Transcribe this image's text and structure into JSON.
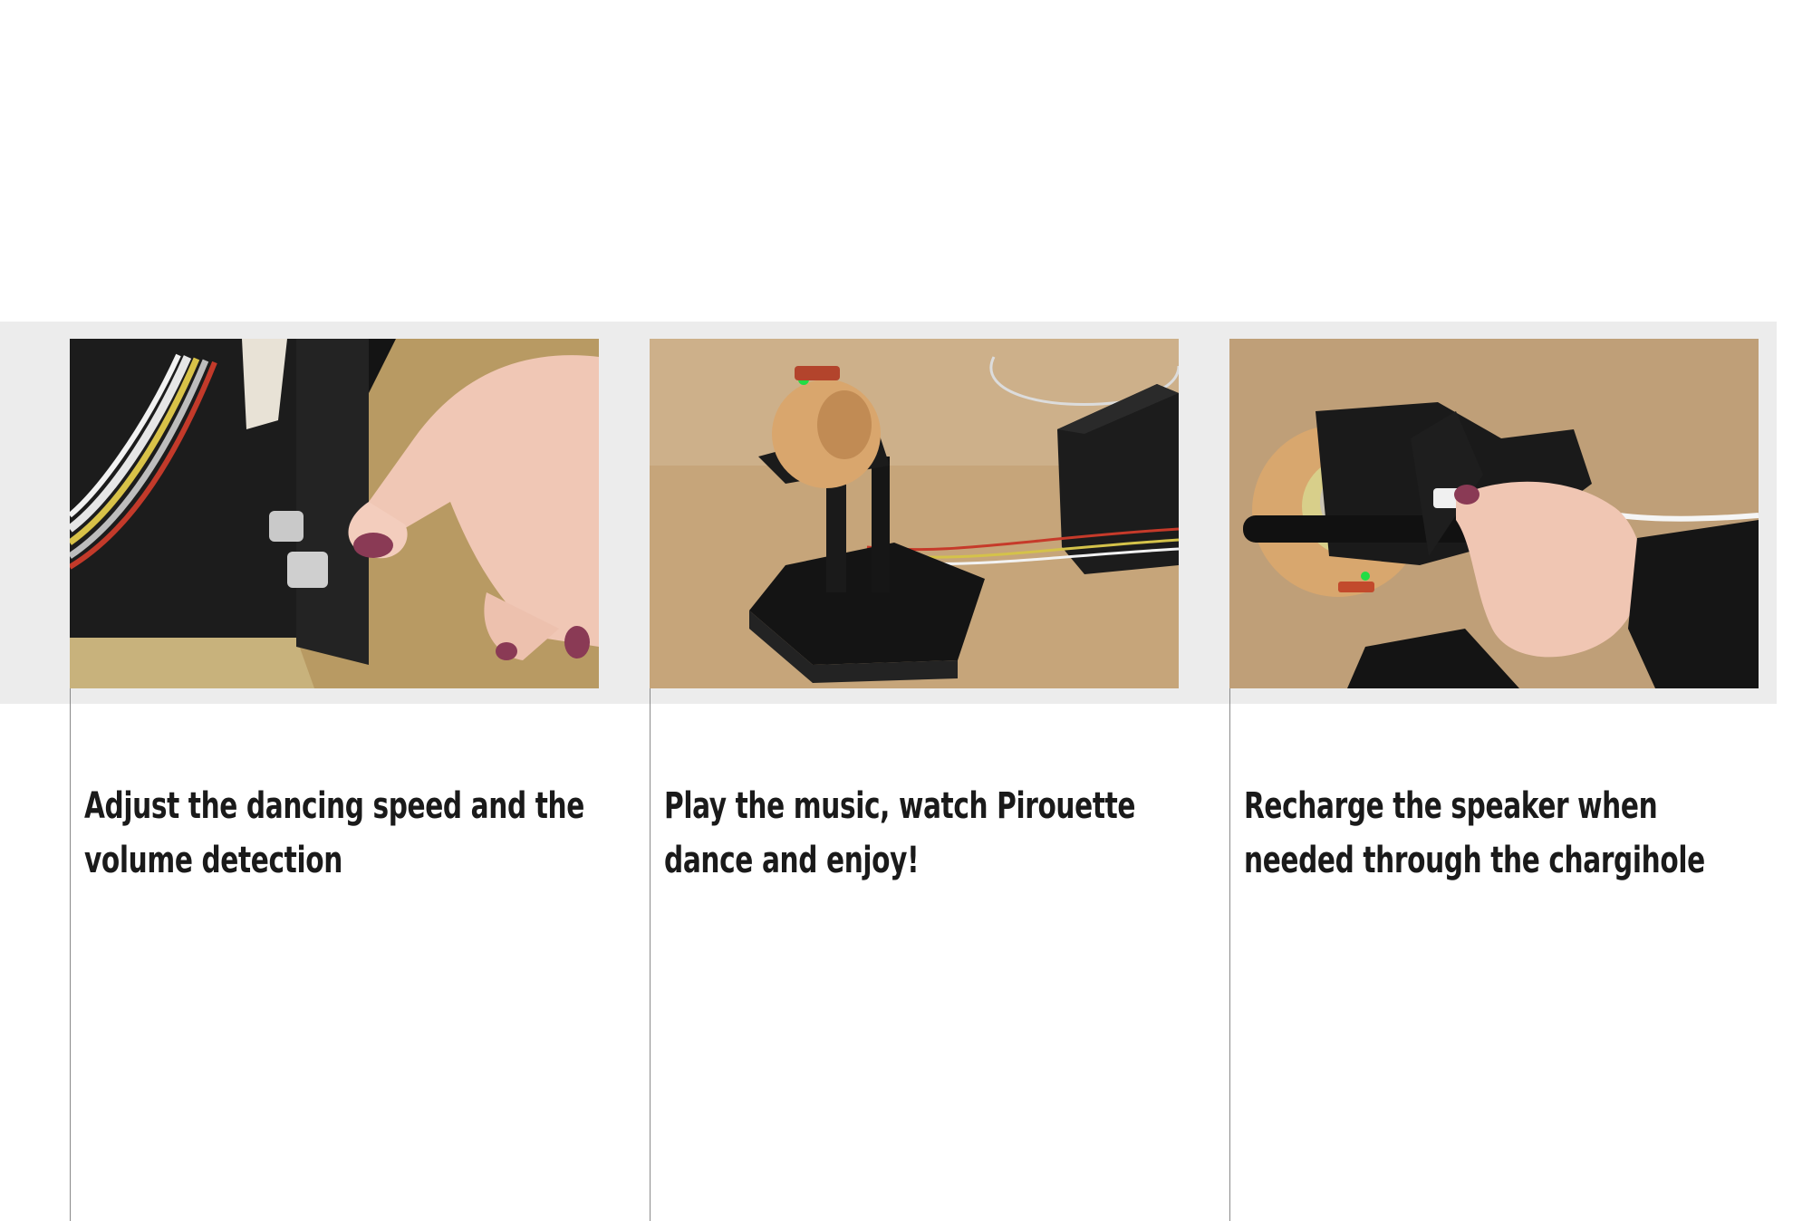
{
  "steps": [
    {
      "caption": "Adjust the dancing speed and the volume detection",
      "photo": {
        "icon": "hand-turning-knobs-photo",
        "colors": {
          "background": "#161616",
          "surface": "#c9b37a"
        }
      }
    },
    {
      "caption": "Play the music, watch Pirouette dance and enjoy!",
      "photo": {
        "icon": "robot-speaker-dancing-photo",
        "colors": {
          "background": "#c9a97d",
          "surface": "#1b1b1b"
        }
      }
    },
    {
      "caption": "Recharge the speaker when needed through the chargihole",
      "photo": {
        "icon": "hand-plugging-charger-photo",
        "colors": {
          "background": "#c1a17a",
          "surface": "#1a1a1a"
        }
      }
    }
  ],
  "colors": {
    "band": "#ececec",
    "text": "#1a1a1a",
    "rule": "#8a8a8a"
  }
}
